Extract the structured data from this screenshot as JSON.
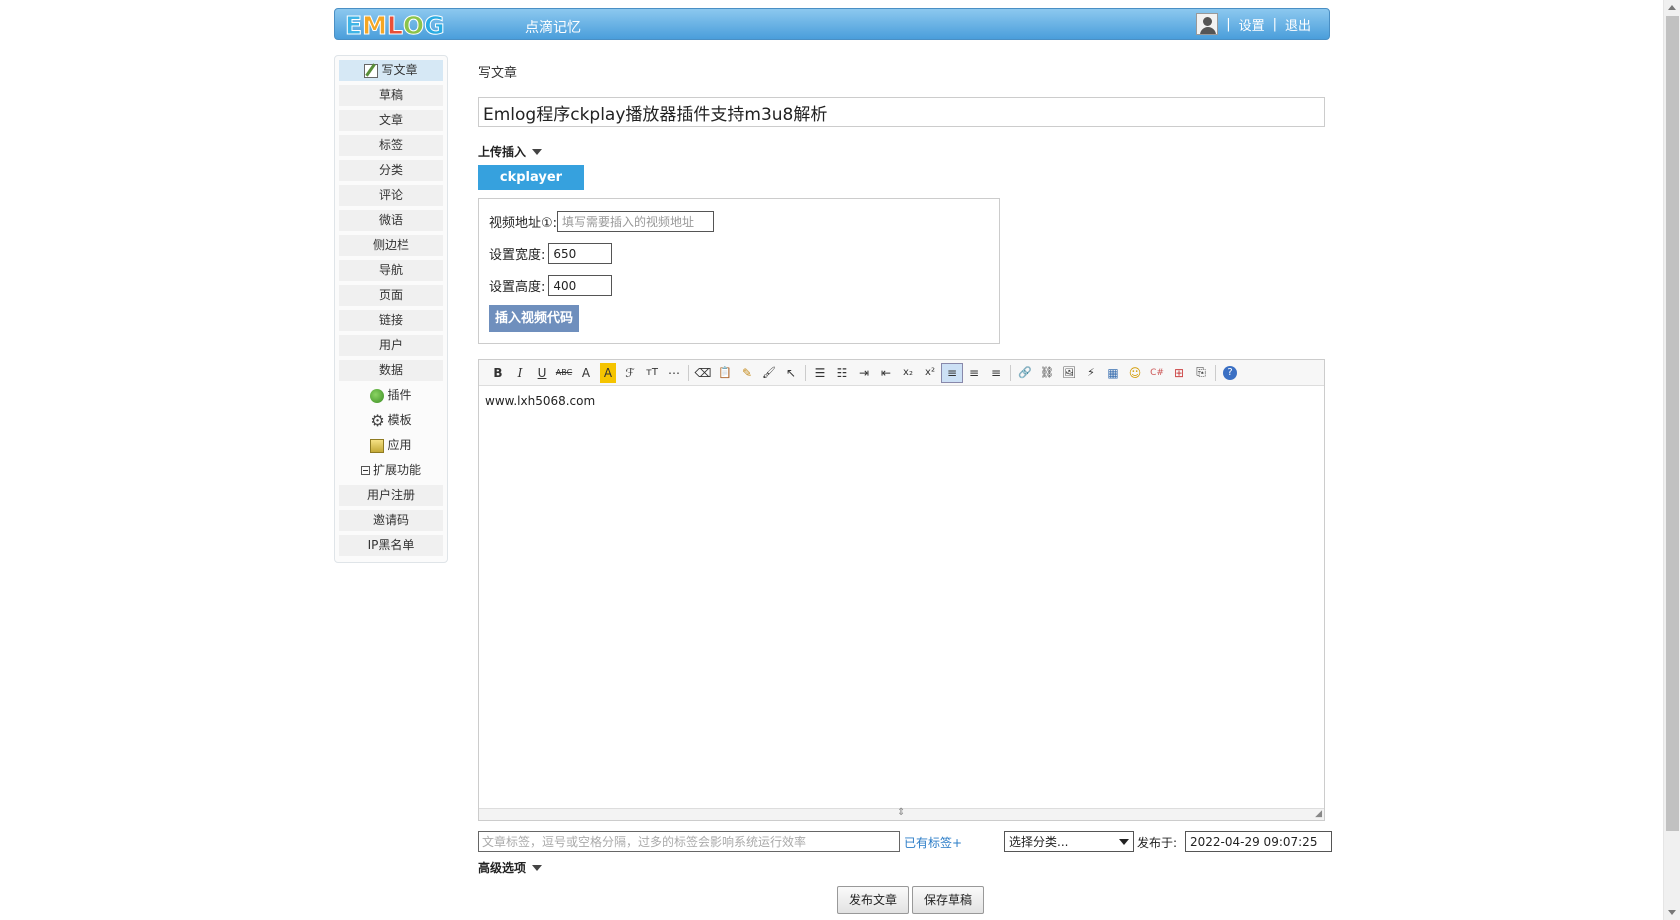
{
  "header": {
    "logo_letters": [
      "E",
      "M",
      "L",
      "O",
      "G"
    ],
    "logo_colors": [
      "#3fb4e6",
      "#f5a623",
      "#e94f37",
      "#8bc34a",
      "#29abe2"
    ],
    "site_name": "点滴记忆",
    "sep": "|",
    "settings": "设置",
    "logout": "退出"
  },
  "sidebar": {
    "items": [
      {
        "label": "写文章",
        "icon": "write-icon"
      },
      {
        "label": "草稿"
      },
      {
        "label": "文章"
      },
      {
        "label": "标签"
      },
      {
        "label": "分类"
      },
      {
        "label": "评论"
      },
      {
        "label": "微语"
      },
      {
        "label": "侧边栏"
      },
      {
        "label": "导航"
      },
      {
        "label": "页面"
      },
      {
        "label": "链接"
      },
      {
        "label": "用户"
      },
      {
        "label": "数据"
      },
      {
        "label": "插件",
        "icon": "plugin-icon"
      },
      {
        "label": "模板",
        "icon": "gear-icon"
      },
      {
        "label": "应用",
        "icon": "app-icon"
      },
      {
        "label": "扩展功能",
        "icon": "collapse-icon"
      },
      {
        "label": "用户注册"
      },
      {
        "label": "邀请码"
      },
      {
        "label": "IP黑名单"
      }
    ]
  },
  "main": {
    "page_title": "写文章",
    "title_value": "Emlog程序ckplay播放器插件支持m3u8解析",
    "upload_label": "上传插入",
    "ck_tab": "ckplayer",
    "ck_video_label": "视频地址①:",
    "ck_video_placeholder": "填写需要插入的视频地址",
    "ck_width_label": "设置宽度:",
    "ck_width_value": "650",
    "ck_height_label": "设置高度:",
    "ck_height_value": "400",
    "ck_insert_label": "插入视频代码",
    "editor_content": "www.lxh5068.com",
    "toolbar": {
      "bold": "B",
      "italic": "I",
      "underline": "U",
      "strike": "ABC",
      "font_color": "A",
      "bg_color": "A",
      "font_family": "ℱ",
      "font_size": "тT",
      "hr": "⋯",
      "eraser": "⌫",
      "paste": "📋",
      "format": "✎",
      "brush": "🖌",
      "pointer": "↖",
      "ol": "☰",
      "ul": "☷",
      "indent": "⇥",
      "outdent": "⇤",
      "sub": "x₂",
      "sup": "x²",
      "align_left": "≡",
      "align_center": "≡",
      "align_right": "≡",
      "link": "🔗",
      "unlink": "⛓",
      "image": "🖼",
      "flash": "⚡",
      "table": "▦",
      "emoji": "☺",
      "code": "C#",
      "pagebreak": "⊞",
      "template": "⎘",
      "help": "?"
    },
    "tags_placeholder": "文章标签，逗号或空格分隔，过多的标签会影响系统运行效率",
    "tags_link": "已有标签+",
    "category_selected": "选择分类...",
    "publish_label": "发布于:",
    "publish_time": "2022-04-29 09:07:25",
    "advanced_label": "高级选项",
    "btn_publish": "发布文章",
    "btn_draft": "保存草稿"
  }
}
